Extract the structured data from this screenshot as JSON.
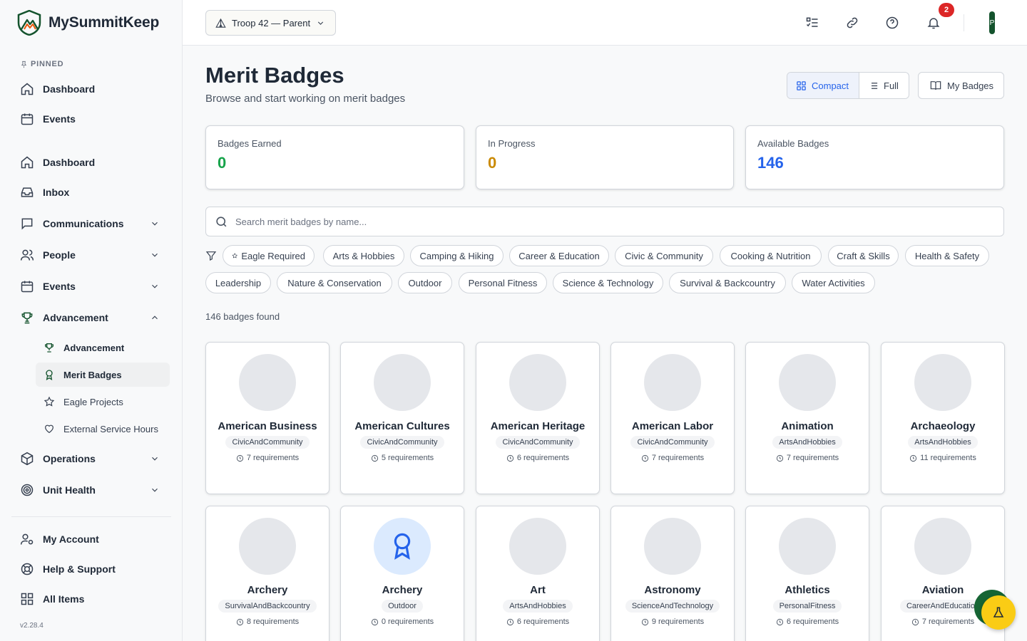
{
  "app": {
    "name": "MySummitKeep",
    "version": "v2.28.4"
  },
  "sidebar": {
    "pinned_label": "PINNED",
    "pinned": [
      {
        "label": "Dashboard",
        "icon": "home-icon"
      },
      {
        "label": "Events",
        "icon": "calendar-icon"
      }
    ],
    "items": [
      {
        "label": "Dashboard",
        "icon": "home-icon"
      },
      {
        "label": "Inbox",
        "icon": "inbox-icon"
      },
      {
        "label": "Communications",
        "icon": "message-icon"
      },
      {
        "label": "People",
        "icon": "users-icon"
      },
      {
        "label": "Events",
        "icon": "calendar-icon"
      },
      {
        "label": "Advancement",
        "icon": "trophy-icon"
      },
      {
        "label": "Operations",
        "icon": "box-icon"
      },
      {
        "label": "Unit Health",
        "icon": "target-icon"
      }
    ],
    "advancement_sub": [
      {
        "label": "Advancement",
        "icon": "trophy-icon"
      },
      {
        "label": "Merit Badges",
        "icon": "award-icon"
      },
      {
        "label": "Eagle Projects",
        "icon": "star-icon"
      },
      {
        "label": "External Service Hours",
        "icon": "heart-icon"
      }
    ],
    "footer": [
      {
        "label": "My Account",
        "icon": "user-cog-icon"
      },
      {
        "label": "Help & Support",
        "icon": "lifebuoy-icon"
      },
      {
        "label": "All Items",
        "icon": "grid-icon"
      }
    ]
  },
  "header": {
    "troop_select": "Troop 42 — Parent",
    "notification_count": "2",
    "avatar_initial": "P"
  },
  "page": {
    "title": "Merit Badges",
    "subtitle": "Browse and start working on merit badges",
    "view_compact": "Compact",
    "view_full": "Full",
    "my_badges": "My Badges"
  },
  "stats": [
    {
      "label": "Badges Earned",
      "value": "0",
      "color": "#16a34a"
    },
    {
      "label": "In Progress",
      "value": "0",
      "color": "#ca8a04"
    },
    {
      "label": "Available Badges",
      "value": "146",
      "color": "#2563eb"
    }
  ],
  "search": {
    "placeholder": "Search merit badges by name..."
  },
  "filters": [
    "Eagle Required",
    "Arts & Hobbies",
    "Camping & Hiking",
    "Career & Education",
    "Civic & Community",
    "Cooking & Nutrition",
    "Craft & Skills",
    "Health & Safety",
    "Leadership",
    "Nature & Conservation",
    "Outdoor",
    "Personal Fitness",
    "Science & Technology",
    "Survival & Backcountry",
    "Water Activities"
  ],
  "results_count": "146 badges found",
  "badges": [
    {
      "name": "American Business",
      "category": "CivicAndCommunity",
      "requirements": "7 requirements"
    },
    {
      "name": "American Cultures",
      "category": "CivicAndCommunity",
      "requirements": "5 requirements"
    },
    {
      "name": "American Heritage",
      "category": "CivicAndCommunity",
      "requirements": "6 requirements"
    },
    {
      "name": "American Labor",
      "category": "CivicAndCommunity",
      "requirements": "7 requirements"
    },
    {
      "name": "Animation",
      "category": "ArtsAndHobbies",
      "requirements": "7 requirements"
    },
    {
      "name": "Archaeology",
      "category": "ArtsAndHobbies",
      "requirements": "11 requirements"
    },
    {
      "name": "Archery",
      "category": "SurvivalAndBackcountry",
      "requirements": "8 requirements"
    },
    {
      "name": "Archery",
      "category": "Outdoor",
      "requirements": "0 requirements"
    },
    {
      "name": "Art",
      "category": "ArtsAndHobbies",
      "requirements": "6 requirements"
    },
    {
      "name": "Astronomy",
      "category": "ScienceAndTechnology",
      "requirements": "9 requirements"
    },
    {
      "name": "Athletics",
      "category": "PersonalFitness",
      "requirements": "6 requirements"
    },
    {
      "name": "Aviation",
      "category": "CareerAndEducation",
      "requirements": "7 requirements"
    }
  ]
}
